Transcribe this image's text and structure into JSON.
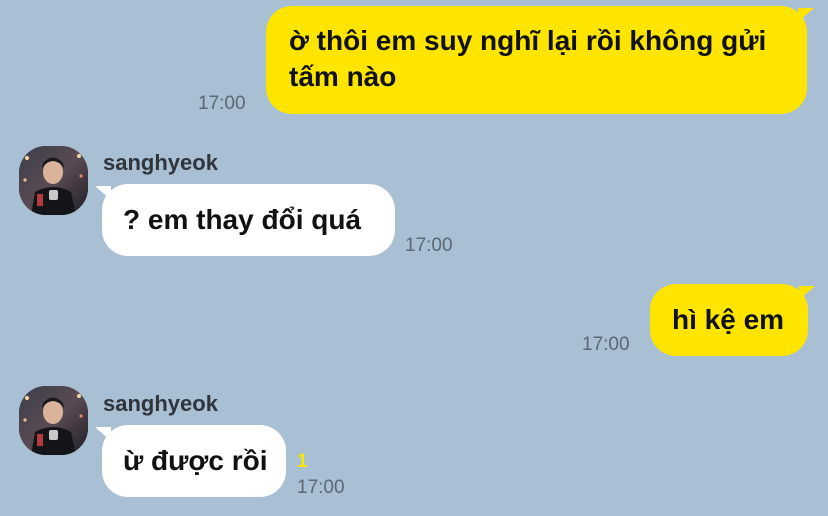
{
  "conversation": {
    "messages": [
      {
        "direction": "outgoing",
        "text": "ờ thôi em suy nghĩ lại rồi không gửi tấm nào",
        "time": "17:00"
      },
      {
        "direction": "incoming",
        "sender": "sanghyeok",
        "text": "? em thay đổi quá",
        "time": "17:00"
      },
      {
        "direction": "outgoing",
        "text": "hì kệ em",
        "time": "17:00"
      },
      {
        "direction": "incoming",
        "sender": "sanghyeok",
        "text": "ừ được rồi",
        "time": "17:00",
        "unread_count": "1"
      }
    ]
  },
  "theme": {
    "background": "#a9bfd3",
    "outgoing_bubble": "#fee500",
    "incoming_bubble": "#ffffff",
    "unread_color": "#fee500"
  },
  "icons": {
    "avatar": "profile-photo-icon"
  }
}
